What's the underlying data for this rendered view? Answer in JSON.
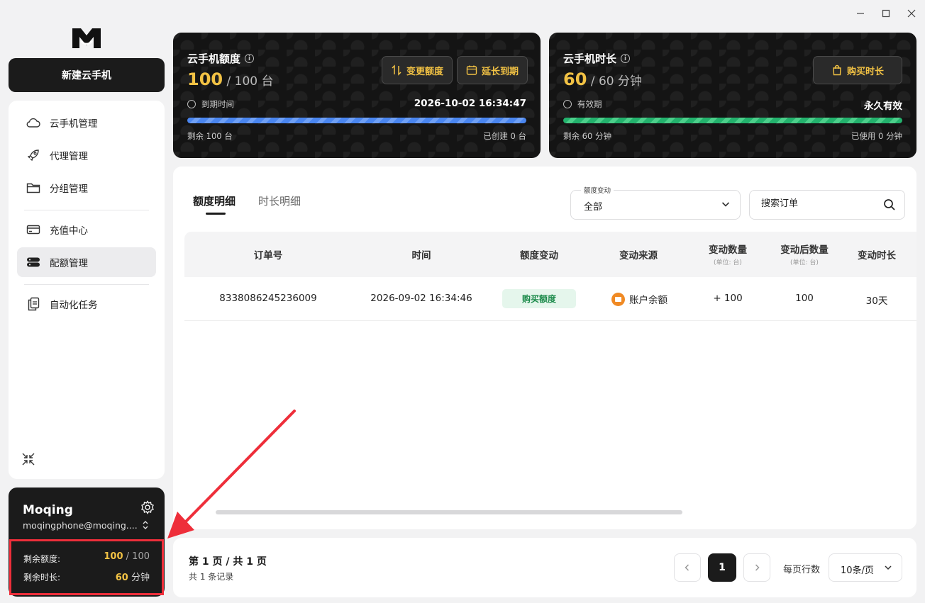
{
  "window": {
    "minimize": "—",
    "maximize": "☐",
    "close": "✕"
  },
  "sidebar": {
    "new_button": "新建云手机",
    "items": [
      {
        "label": "云手机管理",
        "icon": "cloud-icon"
      },
      {
        "label": "代理管理",
        "icon": "rocket-icon"
      },
      {
        "label": "分组管理",
        "icon": "folder-icon"
      },
      {
        "label": "充值中心",
        "icon": "card-icon"
      },
      {
        "label": "配额管理",
        "icon": "server-icon",
        "active": true
      },
      {
        "label": "自动化任务",
        "icon": "clipboard-icon"
      }
    ]
  },
  "user": {
    "name": "Moqing",
    "email": "moqingphone@moqing....",
    "quota_label": "剩余额度:",
    "quota_used": "100",
    "quota_sep": " / ",
    "quota_total": "100",
    "time_label": "剩余时长:",
    "time_value": "60",
    "time_unit": " 分钟"
  },
  "quota_card": {
    "title": "云手机额度",
    "amount": "100",
    "total": " / 100 台",
    "btn_change": "变更额度",
    "btn_extend": "延长到期",
    "expire_label": "到期时间",
    "expire_value": "2026-10-02 16:34:47",
    "progress": 1.0,
    "remaining": "剩余 100 台",
    "created": "已创建 0 台"
  },
  "time_card": {
    "title": "云手机时长",
    "amount": "60",
    "total": " / 60 分钟",
    "btn_buy": "购买时长",
    "valid_label": "有效期",
    "valid_value": "永久有效",
    "progress": 1.0,
    "remaining": "剩余 60 分钟",
    "used": "已使用 0 分钟"
  },
  "tabs": [
    {
      "label": "额度明细",
      "active": true
    },
    {
      "label": "时长明细",
      "active": false
    }
  ],
  "filter": {
    "label": "额度变动",
    "value": "全部"
  },
  "search": {
    "placeholder": "搜索订单"
  },
  "table": {
    "headers": [
      {
        "label": "订单号"
      },
      {
        "label": "时间"
      },
      {
        "label": "额度变动"
      },
      {
        "label": "变动来源"
      },
      {
        "label": "变动数量",
        "sub": "(单位: 台)"
      },
      {
        "label": "变动后数量",
        "sub": "(单位: 台)"
      },
      {
        "label": "变动时长"
      }
    ],
    "rows": [
      {
        "order": "8338086245236009",
        "time": "2026-09-02 16:34:46",
        "change": "购买额度",
        "source": "账户余额",
        "qty": "+ 100",
        "after": "100",
        "duration": "30天"
      }
    ]
  },
  "pagination": {
    "title": "第 1 页 / 共 1 页",
    "sub": "共 1 条记录",
    "current": "1",
    "per_page_label": "每页行数",
    "per_page_value": "10条/页"
  },
  "colors": {
    "accent_gold": "#f2c244",
    "annotation_red": "#ee2e3a",
    "progress_blue": "#4a86f0",
    "progress_green": "#23b26d"
  }
}
